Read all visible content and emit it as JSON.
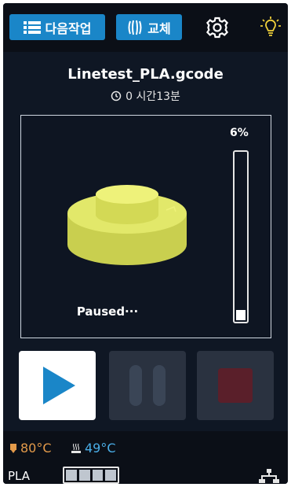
{
  "topbar": {
    "next_job_label": "다음작업",
    "swap_label": "교체",
    "icons": [
      "list-icon",
      "filament-swap-icon",
      "gear-icon",
      "lightbulb-icon"
    ]
  },
  "job": {
    "filename": "Linetest_PLA.gcode",
    "time_remaining": "0 시간13분",
    "progress_percent": 6,
    "progress_label": "6%",
    "status": "Paused···"
  },
  "controls": {
    "play_icon": "play-icon",
    "pause_icon": "pause-icon",
    "stop_icon": "stop-icon"
  },
  "status_bar": {
    "nozzle_temp": "80°C",
    "bed_temp": "49°C",
    "material": "PLA",
    "spool_cells": 4
  },
  "colors": {
    "accent_blue": "#1a86c8",
    "nozzle_temp": "#e39a4a",
    "bed_temp": "#4aaee8",
    "model_yellow": "#d9e05a",
    "play_blue": "#1a86c8",
    "stop_red": "#5a1f2a"
  }
}
